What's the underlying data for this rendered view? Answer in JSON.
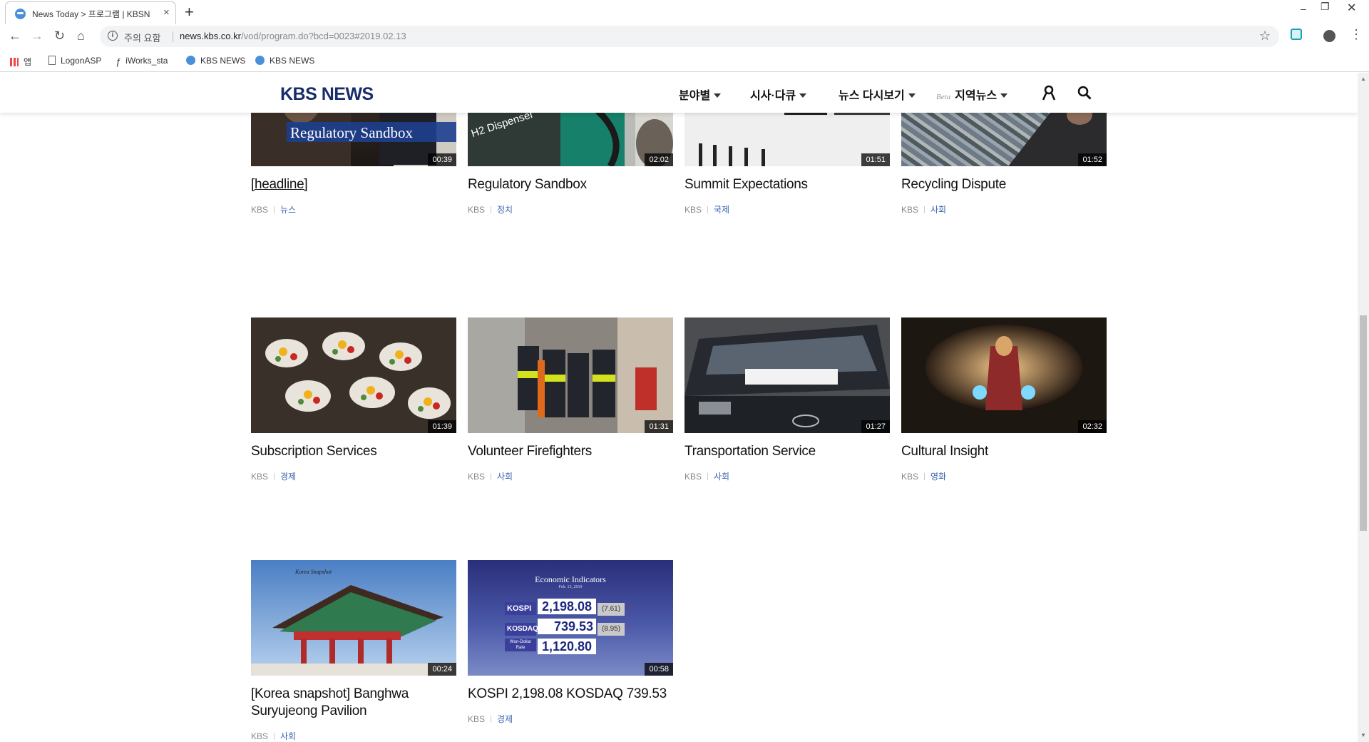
{
  "browser": {
    "tab_title": "News Today > 프로그램 | KBSN",
    "tab_close": "×",
    "new_tab": "+",
    "security_label": "주의 요함",
    "url_host": "news.kbs.co.kr",
    "url_path": "/vod/program.do?bcd=0023#2019.02.13",
    "bookmarks": [
      {
        "label": "앱",
        "icon": "apps-icon"
      },
      {
        "label": "LogonASP",
        "icon": "page-icon"
      },
      {
        "label": "iWorks_sta",
        "icon": "iworks-icon"
      },
      {
        "label": "KBS NEWS",
        "icon": "kbs-icon"
      },
      {
        "label": "KBS NEWS",
        "icon": "kbs-icon"
      }
    ]
  },
  "site": {
    "logo": "KBS NEWS",
    "menu": [
      {
        "label": "분야별"
      },
      {
        "label": "시사·다큐"
      },
      {
        "label": "뉴스 다시보기"
      },
      {
        "label": "지역뉴스",
        "badge": "Beta"
      }
    ]
  },
  "cards": [
    {
      "title": "[headline]",
      "duration": "00:39",
      "source": "KBS",
      "category": "뉴스",
      "thumb_text": "Regulatory Sandbox"
    },
    {
      "title": "Regulatory Sandbox",
      "duration": "02:02",
      "source": "KBS",
      "category": "정치",
      "thumb_text": "H2 Dispenser"
    },
    {
      "title": "Summit Expectations",
      "duration": "01:51",
      "source": "KBS",
      "category": "국제"
    },
    {
      "title": "Recycling Dispute",
      "duration": "01:52",
      "source": "KBS",
      "category": "사회"
    },
    {
      "title": "Subscription Services",
      "duration": "01:39",
      "source": "KBS",
      "category": "경제"
    },
    {
      "title": "Volunteer Firefighters",
      "duration": "01:31",
      "source": "KBS",
      "category": "사회"
    },
    {
      "title": "Transportation Service",
      "duration": "01:27",
      "source": "KBS",
      "category": "사회"
    },
    {
      "title": "Cultural Insight",
      "duration": "02:32",
      "source": "KBS",
      "category": "영화"
    },
    {
      "title": "[Korea snapshot] Banghwa Suryujeong Pavilion",
      "duration": "00:24",
      "source": "KBS",
      "category": "사회",
      "thumb_text": "Korea Snapshot"
    },
    {
      "title": "KOSPI 2,198.08 KOSDAQ 739.53",
      "duration": "00:58",
      "source": "KBS",
      "category": "경제",
      "board": {
        "heading": "Economic Indicators",
        "sub": "Feb. 13, 2019",
        "rows": [
          {
            "name": "KOSPI",
            "value": "2,198.08",
            "change": "(7.61)"
          },
          {
            "name": "KOSDAQ",
            "value": "739.53",
            "change": "(8.95)"
          },
          {
            "name": "Won-Dollar Rate",
            "value": "1,120.80",
            "change": ""
          }
        ]
      }
    }
  ],
  "colors": {
    "logo": "#1a2d6b",
    "category": "#3a64b0"
  }
}
